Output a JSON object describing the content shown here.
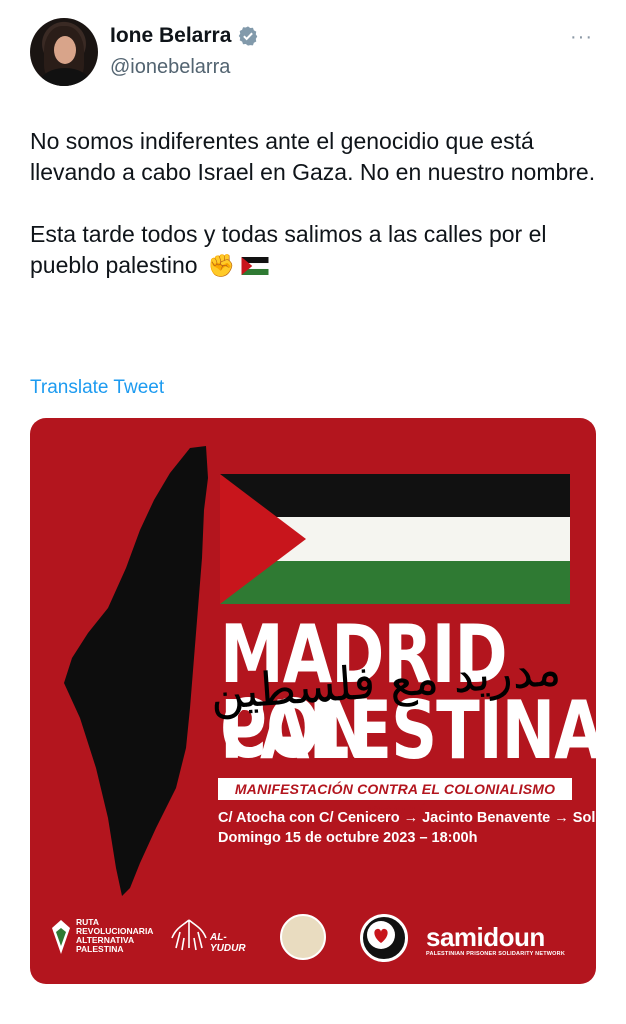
{
  "user": {
    "name": "Ione Belarra",
    "handle": "@ionebelarra",
    "more_glyph": "···"
  },
  "tweet": {
    "paragraph1": "No somos indiferentes ante el genocidio que está llevando a cabo Israel en Gaza. No en nuestro nombre.",
    "paragraph2": "Esta tarde todos y todas salimos a las calles por el pueblo palestino",
    "fist_emoji": "✊",
    "flag_emoji": "palestine-flag-icon",
    "translate_label": "Translate Tweet"
  },
  "poster": {
    "title_line1": "MADRID CON",
    "title_line2": "PALESTINA",
    "arabic_overlay": "مدريد مع فلسطين",
    "banner": "MANIFESTACIÓN CONTRA EL COLONIALISMO ISRAELÍ",
    "route": "C/ Atocha con C/ Cenicero → Jacinto Benavente → Sol",
    "date": "Domingo 15 de octubre 2023 – 18:00h",
    "logos": {
      "ruta": [
        "RUTA",
        "REVOLUCIONARIA",
        "ALTERNATIVA",
        "PALESTINA"
      ],
      "yudur": "AL-YUDUR",
      "samidoun": "samidoun",
      "samidoun_sub": "PALESTINIAN PRISONER SOLIDARITY NETWORK"
    },
    "colors": {
      "background": "#b3151e",
      "flag_black": "#111111",
      "flag_green": "#2f7a33",
      "flag_red": "#c8151c"
    }
  },
  "colors": {
    "link": "#1d9bf0",
    "handle": "#536471",
    "verified": "#829aab"
  }
}
